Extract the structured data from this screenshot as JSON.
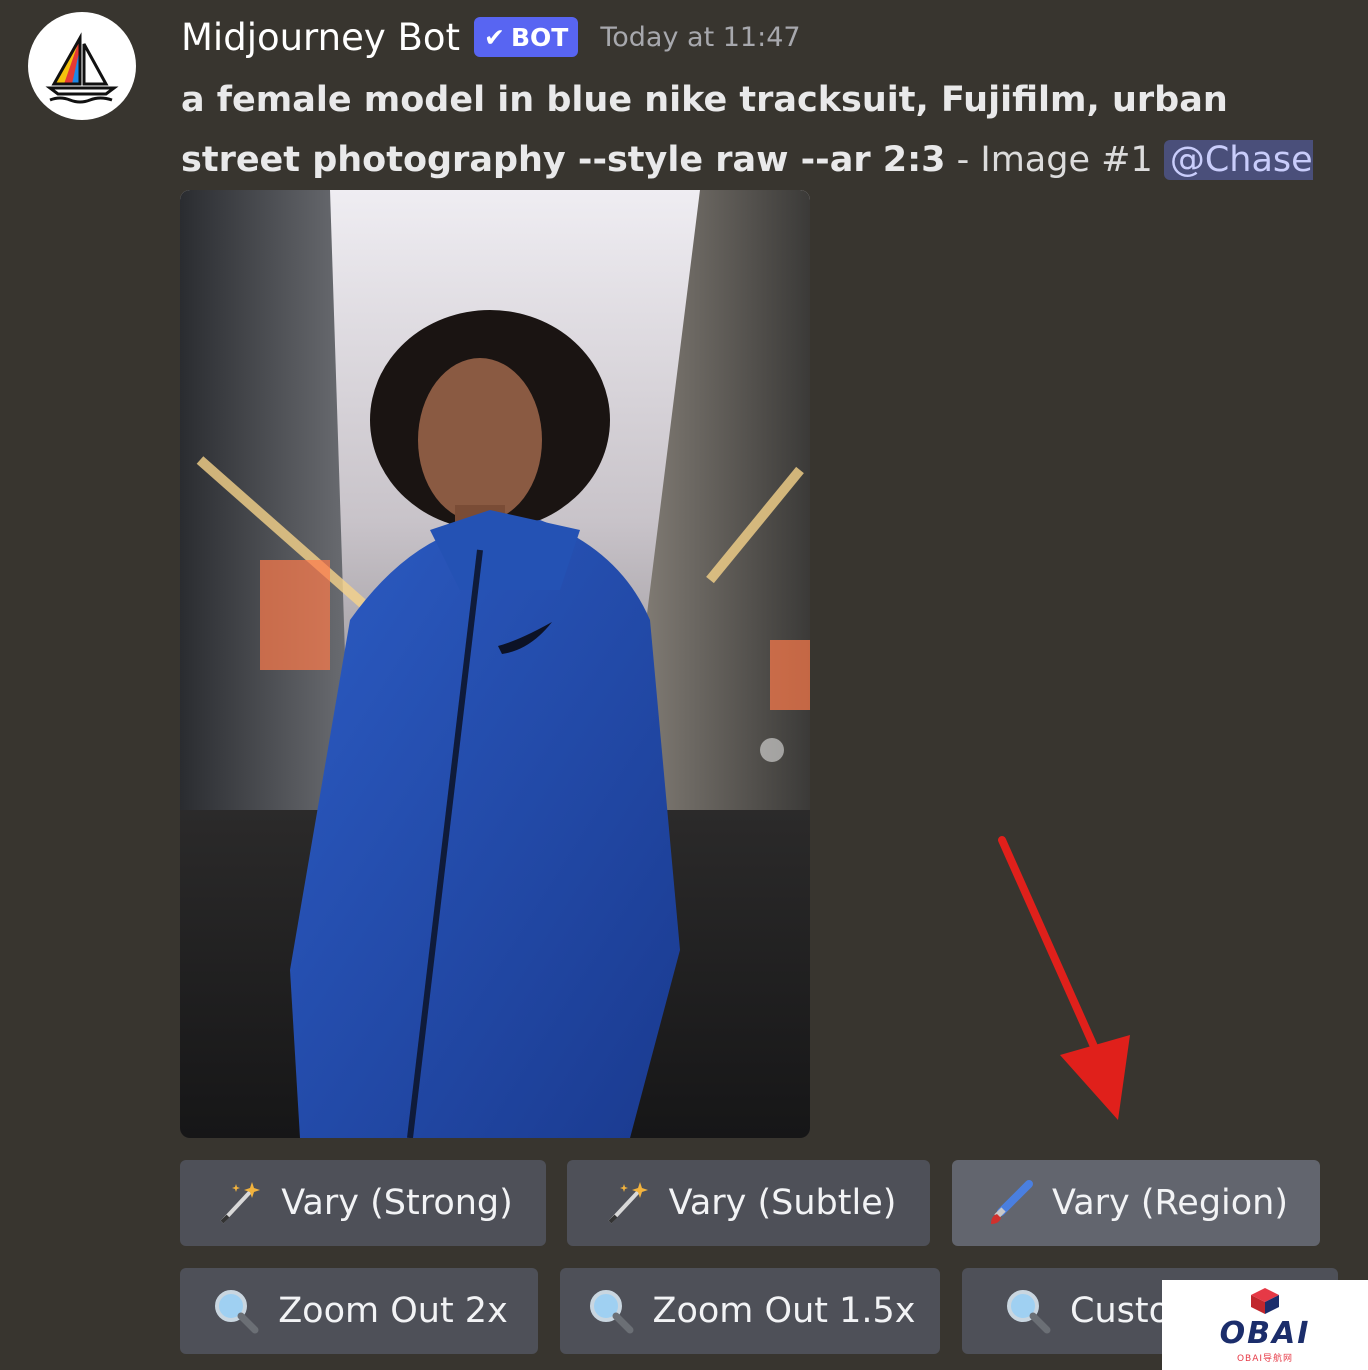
{
  "message": {
    "username": "Midjourney Bot",
    "badge": "BOT",
    "timestamp": "Today at 11:47",
    "prompt_bold": "a female model in blue nike tracksuit, Fujifilm, urban street photography --style raw --ar 2:3",
    "separator": " - ",
    "image_label": "Image #1",
    "mention": "@Chase Lean"
  },
  "buttons": {
    "row1": [
      {
        "label": "Vary (Strong)",
        "icon": "magic-wand-icon"
      },
      {
        "label": "Vary (Subtle)",
        "icon": "magic-wand-icon"
      },
      {
        "label": "Vary (Region)",
        "icon": "paintbrush-icon"
      }
    ],
    "row2": [
      {
        "label": "Zoom Out 2x",
        "icon": "magnifier-icon"
      },
      {
        "label": "Zoom Out 1.5x",
        "icon": "magnifier-icon"
      },
      {
        "label": "Custo",
        "icon": "magnifier-icon"
      }
    ]
  },
  "watermark": {
    "logo": "OBAI",
    "sub": "OBAI导航网"
  },
  "colors": {
    "background": "#38352f",
    "button": "#4e5058",
    "badge": "#5865f2",
    "arrow": "#e0201b"
  }
}
